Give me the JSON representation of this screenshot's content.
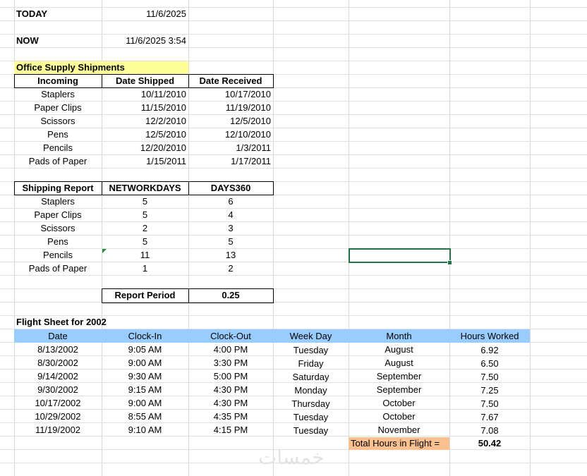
{
  "today": {
    "label": "TODAY",
    "value": "11/6/2025"
  },
  "now": {
    "label": "NOW",
    "value": "11/6/2025 3:54"
  },
  "office": {
    "title": "Office Supply Shipments",
    "headers": [
      "Incoming",
      "Date Shipped",
      "Date Received"
    ],
    "rows": [
      [
        "Staplers",
        "10/11/2010",
        "10/17/2010"
      ],
      [
        "Paper Clips",
        "11/15/2010",
        "11/19/2010"
      ],
      [
        "Scissors",
        "12/2/2010",
        "12/5/2010"
      ],
      [
        "Pens",
        "12/5/2010",
        "12/10/2010"
      ],
      [
        "Pencils",
        "12/20/2010",
        "1/3/2011"
      ],
      [
        "Pads of Paper",
        "1/15/2011",
        "1/17/2011"
      ]
    ]
  },
  "shipping": {
    "headers": [
      "Shipping Report",
      "NETWORKDAYS",
      "DAYS360"
    ],
    "rows": [
      [
        "Staplers",
        "5",
        "6"
      ],
      [
        "Paper Clips",
        "5",
        "4"
      ],
      [
        "Scissors",
        "2",
        "3"
      ],
      [
        "Pens",
        "5",
        "5"
      ],
      [
        "Pencils",
        "11",
        "13"
      ],
      [
        "Pads of Paper",
        "1",
        "2"
      ]
    ]
  },
  "report": {
    "label": "Report Period",
    "value": "0.25"
  },
  "flight": {
    "title": "Flight Sheet for 2002",
    "headers": [
      "Date",
      "Clock-In",
      "Clock-Out",
      "Week Day",
      "Month",
      "Hours Worked"
    ],
    "rows": [
      [
        "8/13/2002",
        "9:05 AM",
        "4:00 PM",
        "Tuesday",
        "August",
        "6.92"
      ],
      [
        "8/30/2002",
        "9:00 AM",
        "3:30 PM",
        "Friday",
        "August",
        "6.50"
      ],
      [
        "9/14/2002",
        "9:30 AM",
        "5:00 PM",
        "Saturday",
        "September",
        "7.50"
      ],
      [
        "9/30/2002",
        "9:15 AM",
        "4:30 PM",
        "Monday",
        "September",
        "7.25"
      ],
      [
        "10/17/2002",
        "9:00 AM",
        "4:30 PM",
        "Thursday",
        "October",
        "7.50"
      ],
      [
        "10/29/2002",
        "8:55 AM",
        "4:35 PM",
        "Tuesday",
        "October",
        "7.67"
      ],
      [
        "11/19/2002",
        "9:10 AM",
        "4:15 PM",
        "Tuesday",
        "November",
        "7.08"
      ]
    ],
    "total_label": "Total Hours in Flight =",
    "total_value": "50.42"
  },
  "watermark": "خمسات",
  "colors": {
    "yellow": "#ffff99",
    "header_blue": "#99ccff",
    "total_orange": "#fac090",
    "selection": "#217346"
  }
}
